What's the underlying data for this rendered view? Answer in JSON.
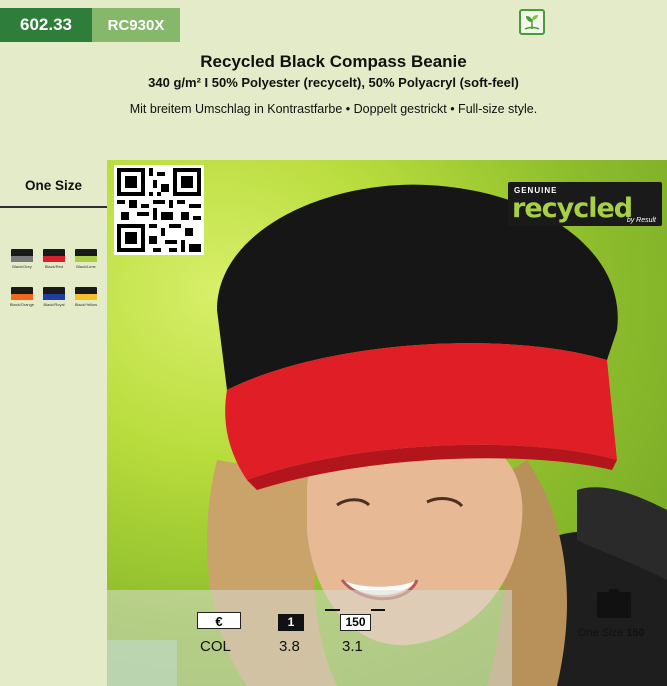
{
  "header": {
    "catalog_code": "602.33",
    "article_code": "RC930X",
    "title": "Recycled Black Compass Beanie",
    "subtitle": "340 g/m² I 50% Polyester (recycelt), 50% Polyacryl (soft-feel)",
    "description": "Mit breitem Umschlag in Kontrastfarbe • Doppelt gestrickt • Full-size style."
  },
  "sidebar": {
    "size_heading": "One Size",
    "swatches": [
      {
        "label": "Black/Grey",
        "top": "#1a1a1a",
        "bottom": "#7a7a7a"
      },
      {
        "label": "Black/Red",
        "top": "#1a1a1a",
        "bottom": "#d81f2a"
      },
      {
        "label": "Black/Lime",
        "top": "#1a1a1a",
        "bottom": "#a8d045"
      },
      {
        "label": "Black/Orange",
        "top": "#1a1a1a",
        "bottom": "#f06a1a"
      },
      {
        "label": "Black/Royal",
        "top": "#1a1a1a",
        "bottom": "#1f3fa0"
      },
      {
        "label": "Black/Yellow",
        "top": "#1a1a1a",
        "bottom": "#f2c02a"
      }
    ]
  },
  "badge": {
    "genuine": "GENUINE",
    "word": "recycled",
    "by": "by Result"
  },
  "pricing": {
    "currency_symbol": "€",
    "col_label": "COL",
    "qty_1": "1",
    "price_1": "3.8",
    "qty_150": "150",
    "price_150": "3.1"
  },
  "packaging": {
    "size_label": "One Size",
    "quantity": "150"
  },
  "colors": {
    "brand_green": "#2e7d3a",
    "light_green": "#86b86c",
    "background": "#e4ebc9"
  },
  "icons": [
    "eco-leaf-icon",
    "qr-code",
    "cap-icon"
  ]
}
